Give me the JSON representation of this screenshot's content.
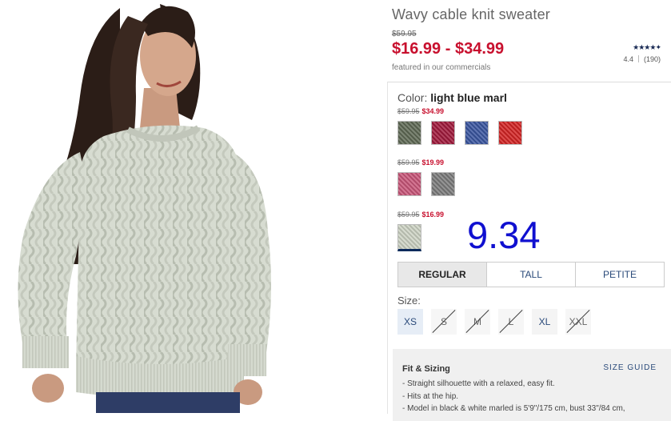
{
  "product": {
    "title": "Wavy cable knit sweater",
    "original_price": "$59.95",
    "price_range": "$16.99 - $34.99",
    "featured_note": "featured in our commercials",
    "rating": {
      "stars": "★★★★✦",
      "score": "4.4",
      "count": "(190)"
    }
  },
  "color": {
    "label": "Color:",
    "selected": "light blue marl"
  },
  "swatch_groups": [
    {
      "old": "$59.95",
      "new": "$34.99",
      "swatches": [
        {
          "name": "olive",
          "color": "#5f6a55"
        },
        {
          "name": "berry",
          "color": "#a11a3c"
        },
        {
          "name": "blue",
          "color": "#3a56a0"
        },
        {
          "name": "red",
          "color": "#d42424"
        }
      ]
    },
    {
      "old": "$59.95",
      "new": "$19.99",
      "swatches": [
        {
          "name": "pink",
          "color": "#c9577a"
        },
        {
          "name": "grey",
          "color": "#7c7c7c"
        }
      ]
    },
    {
      "old": "$59.95",
      "new": "$16.99",
      "swatches": [
        {
          "name": "light blue marl",
          "color": "#cdd3c4"
        }
      ]
    }
  ],
  "overlay_value": "9.34",
  "fit_tabs": [
    "REGULAR",
    "TALL",
    "PETITE"
  ],
  "size": {
    "label": "Size:",
    "options": [
      "XS",
      "S",
      "M",
      "L",
      "XL",
      "XXL"
    ]
  },
  "fit_sizing": {
    "heading": "Fit & Sizing",
    "size_guide": "SIZE GUIDE",
    "bullets": [
      "- Straight silhouette with a relaxed, easy fit.",
      "- Hits at the hip.",
      "- Model in black & white marled is 5'9\"/175 cm, bust 33\"/84 cm,"
    ]
  }
}
